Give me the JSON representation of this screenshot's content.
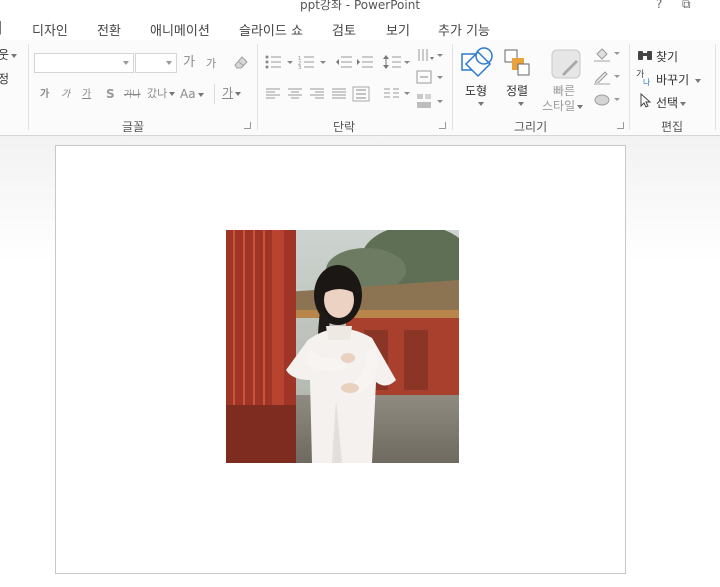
{
  "window": {
    "title": "ppt강좌 - PowerPoint",
    "help_glyph": "?",
    "restore_glyph": "⧉"
  },
  "tabs": [
    {
      "label": "디자인"
    },
    {
      "label": "전환"
    },
    {
      "label": "애니메이션"
    },
    {
      "label": "슬라이드 쇼"
    },
    {
      "label": "검토"
    },
    {
      "label": "보기"
    },
    {
      "label": "추가 기능"
    }
  ],
  "tab_partial": "|",
  "slides_group": {
    "layout_fragment": "웃",
    "reset_fragment": "정"
  },
  "font_group": {
    "label": "글꼴",
    "font_name_value": "",
    "font_size_value": "",
    "grow_font": "가",
    "shrink_font": "가",
    "clear_format": "가",
    "bold": "가",
    "italic": "가",
    "underline": "가",
    "shadow": "S",
    "strikethrough": "가나",
    "char_spacing": "갔나",
    "change_case": "Aa",
    "font_color": "가"
  },
  "paragraph_group": {
    "label": "단락"
  },
  "drawing_group": {
    "label": "그리기",
    "shapes_label": "도형",
    "arrange_label": "정렬",
    "quick_styles_label_1": "빠른",
    "quick_styles_label_2": "스타일"
  },
  "editing_group": {
    "label": "편집",
    "find_label": "찾기",
    "replace_label": "바꾸기",
    "select_label": "선택"
  },
  "slide": {
    "image_alt": "photo"
  },
  "colors": {
    "accent_blue": "#2b79d0",
    "arrange_orange": "#e8a33c",
    "wall_red": "#b5402c",
    "dress_white": "#f4f1ee"
  }
}
